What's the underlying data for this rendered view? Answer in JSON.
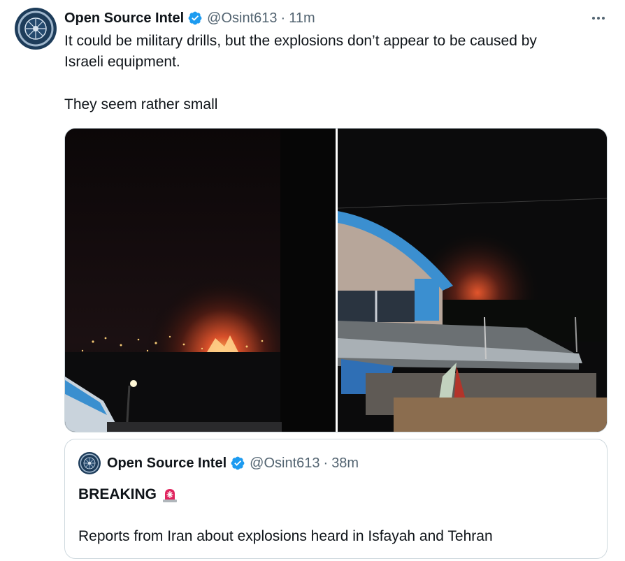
{
  "tweet": {
    "author_name": "Open Source Intel",
    "handle": "@Osint613",
    "separator": "·",
    "time": "11m",
    "text_line1": "It could be military drills, but the explosions don’t appear to be caused by",
    "text_line2": "Israeli equipment.",
    "text_line3": "They seem rather small"
  },
  "media": {
    "photo_left_icon": "night-explosion-photo",
    "photo_right_icon": "night-explosion-rooftop-photo"
  },
  "quoted_tweet": {
    "author_name": "Open Source Intel",
    "handle": "@Osint613",
    "separator": "·",
    "time": "38m",
    "title": "BREAKING",
    "title_icon": "siren-icon",
    "body": "Reports from Iran about explosions heard in Isfayah and Tehran"
  },
  "colors": {
    "verified_blue": "#1d9bf0",
    "secondary_text": "#536471",
    "border": "#cfd9de"
  }
}
